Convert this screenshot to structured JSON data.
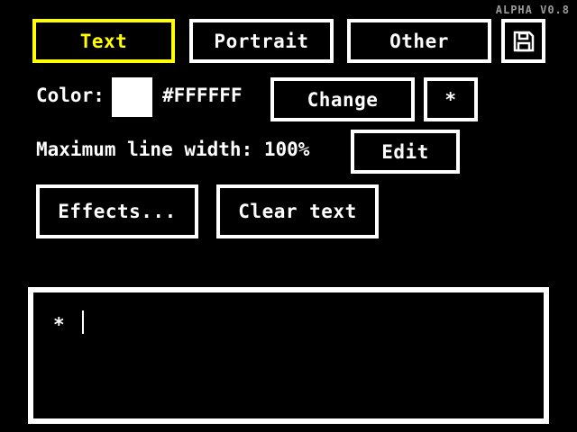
{
  "app": {
    "version": "ALPHA V0.8"
  },
  "tabs": [
    {
      "label": "Text",
      "active": true
    },
    {
      "label": "Portrait",
      "active": false
    },
    {
      "label": "Other",
      "active": false
    }
  ],
  "toolbar": {
    "save_icon": "floppy-disk-icon"
  },
  "color": {
    "label": "Color:",
    "value": "#FFFFFF",
    "hex_text": "#FFFFFF",
    "change_label": "Change",
    "asterisk_label": "*"
  },
  "line_width": {
    "label": "Maximum line width: 100%",
    "edit_label": "Edit"
  },
  "actions": {
    "effects_label": "Effects...",
    "clear_label": "Clear text"
  },
  "editor": {
    "prefix": "*",
    "text": ""
  },
  "colors": {
    "active": "#FFFF00",
    "border": "#FFFFFF",
    "background": "#000000"
  }
}
